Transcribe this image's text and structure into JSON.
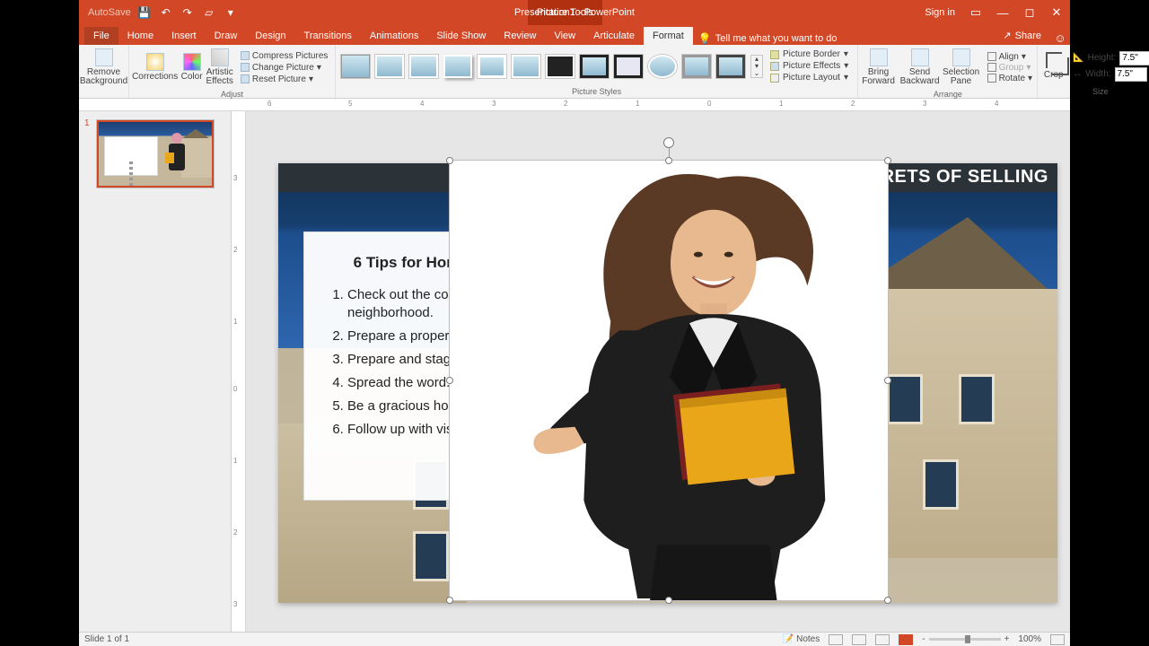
{
  "titlebar": {
    "autosave": "AutoSave",
    "doc": "Presentation1 - PowerPoint",
    "ptools": "Picture Tools",
    "signin": "Sign in"
  },
  "tabs": {
    "file": "File",
    "home": "Home",
    "insert": "Insert",
    "draw": "Draw",
    "design": "Design",
    "transitions": "Transitions",
    "animations": "Animations",
    "slideshow": "Slide Show",
    "review": "Review",
    "view": "View",
    "articulate": "Articulate",
    "format": "Format",
    "tellme": "Tell me what you want to do",
    "share": "Share"
  },
  "ribbon": {
    "removebg": "Remove Background",
    "corrections": "Corrections",
    "color": "Color",
    "artistic": "Artistic Effects",
    "adjust_label": "Adjust",
    "compress": "Compress Pictures",
    "change": "Change Picture",
    "reset": "Reset Picture",
    "pstyles_label": "Picture Styles",
    "pborder": "Picture Border",
    "peffects": "Picture Effects",
    "playout": "Picture Layout",
    "bringfwd": "Bring Forward",
    "sendback": "Send Backward",
    "selpane": "Selection Pane",
    "align": "Align",
    "group": "Group",
    "rotate": "Rotate",
    "arrange_label": "Arrange",
    "crop": "Crop",
    "height_l": "Height:",
    "width_l": "Width:",
    "height_v": "7.5\"",
    "width_v": "7.5\"",
    "size_label": "Size"
  },
  "slide": {
    "banner": "SECRETS OF SELLING",
    "card_title": "6 Tips for Home Sellers",
    "tips": [
      "Check out the competition in your neighborhood.",
      "Prepare a property flyer.",
      "Prepare and stage the home.",
      "Spread the word.",
      "Be a gracious host.",
      "Follow up with visitors."
    ]
  },
  "thumb": {
    "num": "1"
  },
  "status": {
    "slide": "Slide 1 of 1",
    "notes": "Notes",
    "zoom": "100%"
  }
}
